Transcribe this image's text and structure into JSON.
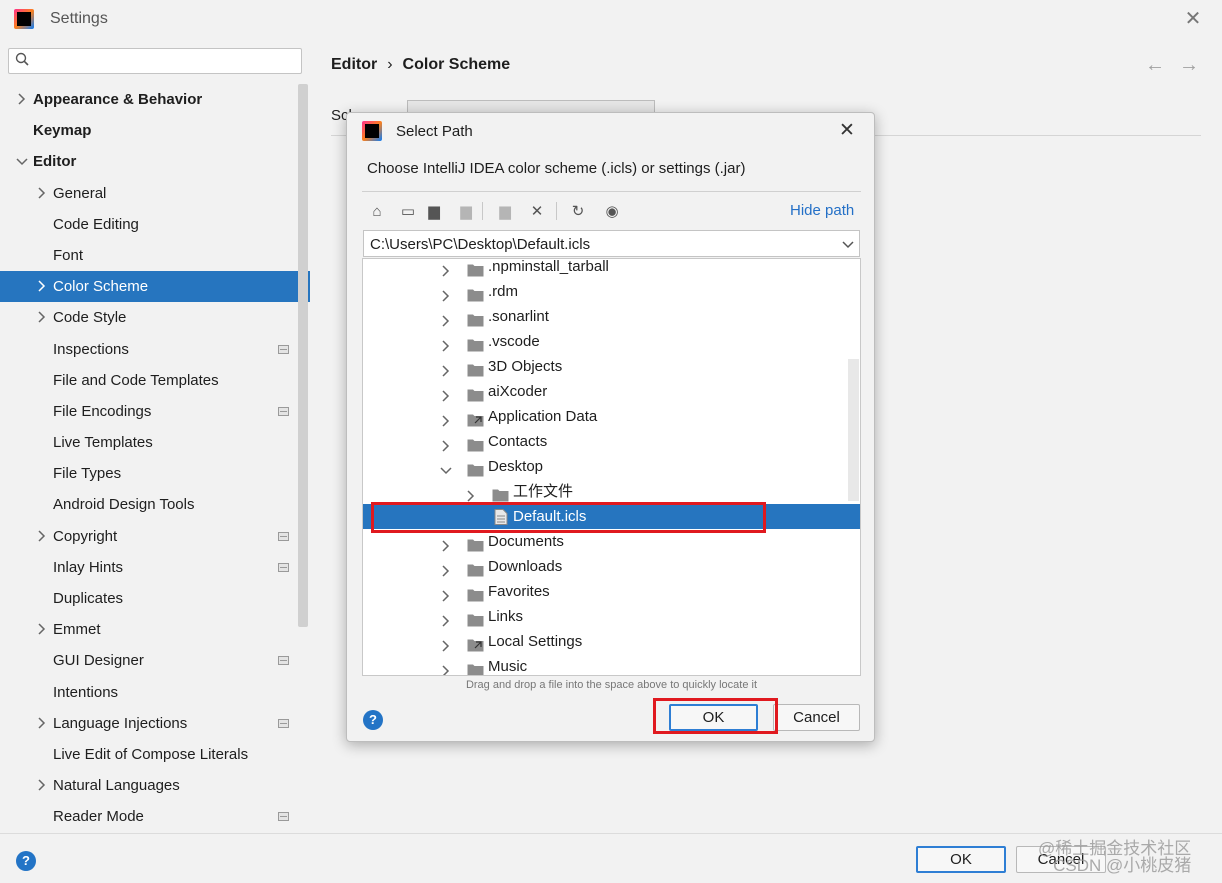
{
  "window": {
    "title": "Settings"
  },
  "search": {
    "placeholder": ""
  },
  "sidebar": {
    "items": [
      {
        "label": "Appearance & Behavior",
        "indent": 0,
        "chevron": "right",
        "bold": true,
        "project": false
      },
      {
        "label": "Keymap",
        "indent": 0,
        "chevron": "",
        "bold": true,
        "project": false
      },
      {
        "label": "Editor",
        "indent": 0,
        "chevron": "down",
        "bold": true,
        "project": false
      },
      {
        "label": "General",
        "indent": 1,
        "chevron": "right",
        "bold": false,
        "project": false
      },
      {
        "label": "Code Editing",
        "indent": 1,
        "chevron": "",
        "bold": false,
        "project": false
      },
      {
        "label": "Font",
        "indent": 1,
        "chevron": "",
        "bold": false,
        "project": false
      },
      {
        "label": "Color Scheme",
        "indent": 1,
        "chevron": "right",
        "bold": false,
        "project": false,
        "selected": true
      },
      {
        "label": "Code Style",
        "indent": 1,
        "chevron": "right",
        "bold": false,
        "project": false
      },
      {
        "label": "Inspections",
        "indent": 1,
        "chevron": "",
        "bold": false,
        "project": true
      },
      {
        "label": "File and Code Templates",
        "indent": 1,
        "chevron": "",
        "bold": false,
        "project": false
      },
      {
        "label": "File Encodings",
        "indent": 1,
        "chevron": "",
        "bold": false,
        "project": true
      },
      {
        "label": "Live Templates",
        "indent": 1,
        "chevron": "",
        "bold": false,
        "project": false
      },
      {
        "label": "File Types",
        "indent": 1,
        "chevron": "",
        "bold": false,
        "project": false
      },
      {
        "label": "Android Design Tools",
        "indent": 1,
        "chevron": "",
        "bold": false,
        "project": false
      },
      {
        "label": "Copyright",
        "indent": 1,
        "chevron": "right",
        "bold": false,
        "project": true
      },
      {
        "label": "Inlay Hints",
        "indent": 1,
        "chevron": "",
        "bold": false,
        "project": true
      },
      {
        "label": "Duplicates",
        "indent": 1,
        "chevron": "",
        "bold": false,
        "project": false
      },
      {
        "label": "Emmet",
        "indent": 1,
        "chevron": "right",
        "bold": false,
        "project": false
      },
      {
        "label": "GUI Designer",
        "indent": 1,
        "chevron": "",
        "bold": false,
        "project": true
      },
      {
        "label": "Intentions",
        "indent": 1,
        "chevron": "",
        "bold": false,
        "project": false
      },
      {
        "label": "Language Injections",
        "indent": 1,
        "chevron": "right",
        "bold": false,
        "project": true
      },
      {
        "label": "Live Edit of Compose Literals",
        "indent": 1,
        "chevron": "",
        "bold": false,
        "project": false
      },
      {
        "label": "Natural Languages",
        "indent": 1,
        "chevron": "right",
        "bold": false,
        "project": false
      },
      {
        "label": "Reader Mode",
        "indent": 1,
        "chevron": "",
        "bold": false,
        "project": true
      }
    ]
  },
  "main": {
    "breadcrumb": {
      "parent": "Editor",
      "separator": "›",
      "current": "Color Scheme"
    },
    "scheme_label": "Sch",
    "nav_back": "←",
    "nav_forward": "→"
  },
  "dialog": {
    "title": "Select Path",
    "close": "✕",
    "description": "Choose IntelliJ IDEA color scheme (.icls) or settings (.jar)",
    "hide_path": "Hide path",
    "path_value": "C:\\Users\\PC\\Desktop\\Default.icls",
    "toolbar": [
      {
        "icon": "home-icon",
        "glyph": "⌂",
        "disabled": false
      },
      {
        "icon": "desktop-icon",
        "glyph": "▭",
        "disabled": false
      },
      {
        "icon": "project-folder-icon",
        "glyph": "▆",
        "disabled": false
      },
      {
        "icon": "module-folder-icon",
        "glyph": "▆",
        "disabled": true
      },
      {
        "icon": "new-folder-icon",
        "glyph": "▆",
        "disabled": true
      },
      {
        "icon": "delete-icon",
        "glyph": "✕",
        "disabled": false
      },
      {
        "icon": "refresh-icon",
        "glyph": "↻",
        "disabled": false
      },
      {
        "icon": "show-hidden-icon",
        "glyph": "◉",
        "disabled": false
      }
    ],
    "files": [
      {
        "label": ".npminstall_tarball",
        "level": 1,
        "expanded": false,
        "type": "folder"
      },
      {
        "label": ".rdm",
        "level": 1,
        "expanded": false,
        "type": "folder"
      },
      {
        "label": ".sonarlint",
        "level": 1,
        "expanded": false,
        "type": "folder"
      },
      {
        "label": ".vscode",
        "level": 1,
        "expanded": false,
        "type": "folder"
      },
      {
        "label": "3D Objects",
        "level": 1,
        "expanded": false,
        "type": "folder"
      },
      {
        "label": "aiXcoder",
        "level": 1,
        "expanded": false,
        "type": "folder"
      },
      {
        "label": "Application Data",
        "level": 1,
        "expanded": false,
        "type": "link"
      },
      {
        "label": "Contacts",
        "level": 1,
        "expanded": false,
        "type": "folder"
      },
      {
        "label": "Desktop",
        "level": 1,
        "expanded": true,
        "type": "folder"
      },
      {
        "label": "工作文件",
        "level": 2,
        "expanded": false,
        "type": "folder"
      },
      {
        "label": "Default.icls",
        "level": 2,
        "expanded": null,
        "type": "file",
        "selected": true
      },
      {
        "label": "Documents",
        "level": 1,
        "expanded": false,
        "type": "folder"
      },
      {
        "label": "Downloads",
        "level": 1,
        "expanded": false,
        "type": "folder"
      },
      {
        "label": "Favorites",
        "level": 1,
        "expanded": false,
        "type": "folder"
      },
      {
        "label": "Links",
        "level": 1,
        "expanded": false,
        "type": "folder"
      },
      {
        "label": "Local Settings",
        "level": 1,
        "expanded": false,
        "type": "link"
      },
      {
        "label": "Music",
        "level": 1,
        "expanded": false,
        "type": "folder"
      }
    ],
    "drag_hint": "Drag and drop a file into the space above to quickly locate it",
    "ok_label": "OK",
    "cancel_label": "Cancel",
    "help": "?"
  },
  "footer": {
    "help": "?",
    "ok_label": "OK",
    "cancel_label": "Cancel"
  },
  "watermark": {
    "line1": "@稀土掘金技术社区",
    "line2": "CSDN @小桃皮猪"
  },
  "colors": {
    "accent": "#2675bf",
    "link": "#2470c7",
    "highlight": "#e0191f",
    "folder": "#8c8c8c"
  }
}
